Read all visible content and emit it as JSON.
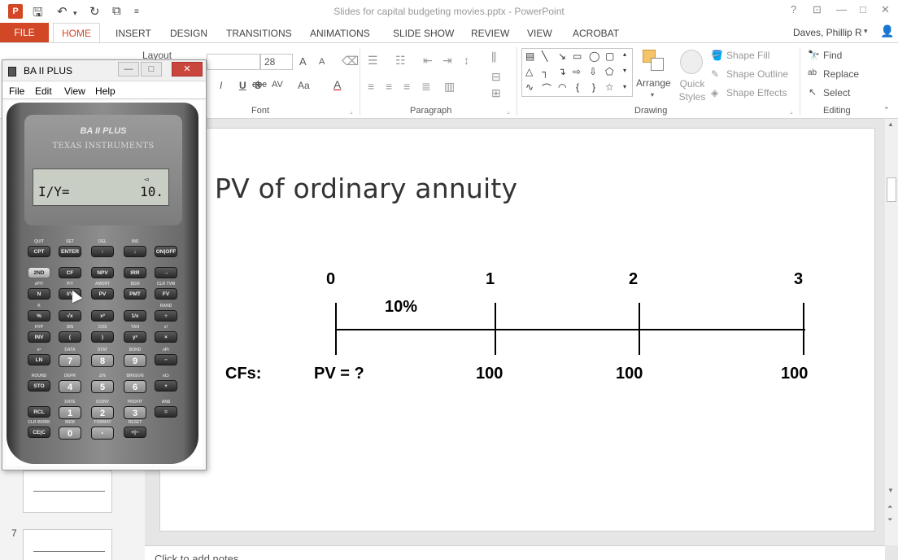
{
  "app": {
    "app_icon_label": "P",
    "title": "Slides for capital budgeting movies.pptx - PowerPoint",
    "window_controls": {
      "help": "?",
      "restore_ribbon": "⊡",
      "minimize": "—",
      "maximize": "□",
      "close": "✕"
    }
  },
  "quick_access": {
    "save_icon": "floppy-icon",
    "undo_icon": "undo-icon",
    "redo_icon": "redo-icon",
    "present_icon": "present-icon",
    "customize_icon": "chevron-down-icon"
  },
  "ribbon": {
    "tabs": [
      "FILE",
      "HOME",
      "INSERT",
      "DESIGN",
      "TRANSITIONS",
      "ANIMATIONS",
      "SLIDE SHOW",
      "REVIEW",
      "VIEW",
      "ACROBAT"
    ],
    "active_tab": "HOME",
    "user": "Daves, Phillip R",
    "groups": {
      "font": {
        "label": "Font",
        "font_size": "28",
        "bold": "B",
        "italic": "I",
        "underline": "U",
        "shadow": "S",
        "strike": "abc",
        "spacing": "AV",
        "case": "Aa",
        "color": "A",
        "grow": "A",
        "shrink": "A"
      },
      "paragraph": {
        "label": "Paragraph"
      },
      "drawing": {
        "label": "Drawing",
        "arrange": "Arrange",
        "quick_styles": "Quick Styles",
        "shape_fill": "Shape Fill",
        "shape_outline": "Shape Outline",
        "shape_effects": "Shape Effects"
      },
      "editing": {
        "label": "Editing",
        "find": "Find",
        "replace": "Replace",
        "select": "Select"
      },
      "slides": {
        "layout": "Layout"
      }
    }
  },
  "calculator_window": {
    "title": "BA II PLUS",
    "menu": [
      "File",
      "Edit",
      "View",
      "Help"
    ],
    "brand": "BA II PLUS",
    "maker": "TEXAS INSTRUMENTS",
    "display": {
      "label": "I/Y=",
      "value": "10.",
      "indicator": "◅"
    },
    "keys": [
      {
        "sec": "QUIT",
        "label": "CPT"
      },
      {
        "sec": "SET",
        "label": "ENTER"
      },
      {
        "sec": "DEL",
        "label": "↑"
      },
      {
        "sec": "INS",
        "label": "↓"
      },
      {
        "sec": "",
        "label": "ON|OFF"
      },
      {
        "sec": "",
        "label": "2ND"
      },
      {
        "sec": "",
        "label": "CF"
      },
      {
        "sec": "",
        "label": "NPV"
      },
      {
        "sec": "",
        "label": "IRR"
      },
      {
        "sec": "",
        "label": "→"
      },
      {
        "sec": "xP/Y",
        "label": "N"
      },
      {
        "sec": "P/Y",
        "label": "I/Y"
      },
      {
        "sec": "AMORT",
        "label": "PV"
      },
      {
        "sec": "BGN",
        "label": "PMT"
      },
      {
        "sec": "CLR TVM",
        "label": "FV"
      },
      {
        "sec": "K",
        "label": "%"
      },
      {
        "sec": "",
        "label": "√x"
      },
      {
        "sec": "",
        "label": "x²"
      },
      {
        "sec": "",
        "label": "1/x"
      },
      {
        "sec": "RAND",
        "label": "÷"
      },
      {
        "sec": "HYP",
        "label": "INV"
      },
      {
        "sec": "SIN",
        "label": "("
      },
      {
        "sec": "COS",
        "label": ")"
      },
      {
        "sec": "TAN",
        "label": "yˣ"
      },
      {
        "sec": "x!",
        "label": "×"
      },
      {
        "sec": "eˣ",
        "label": "LN"
      },
      {
        "sec": "DATA",
        "label": "7"
      },
      {
        "sec": "STAT",
        "label": "8"
      },
      {
        "sec": "BOND",
        "label": "9"
      },
      {
        "sec": "nPr",
        "label": "−"
      },
      {
        "sec": "ROUND",
        "label": "STO"
      },
      {
        "sec": "DEPR",
        "label": "4"
      },
      {
        "sec": "Δ%",
        "label": "5"
      },
      {
        "sec": "BRKEVN",
        "label": "6"
      },
      {
        "sec": "nCr",
        "label": "+"
      },
      {
        "sec": "",
        "label": "RCL"
      },
      {
        "sec": "DATE",
        "label": "1"
      },
      {
        "sec": "ICONV",
        "label": "2"
      },
      {
        "sec": "PROFIT",
        "label": "3"
      },
      {
        "sec": "ANS",
        "label": "="
      },
      {
        "sec": "CLR WORK",
        "label": "CE|C"
      },
      {
        "sec": "MEM",
        "label": "0"
      },
      {
        "sec": "FORMAT",
        "label": "·"
      },
      {
        "sec": "RESET",
        "label": "+|−"
      },
      {
        "sec": "",
        "label": ""
      }
    ]
  },
  "slide": {
    "title": "PV of ordinary annuity",
    "periods": [
      "0",
      "1",
      "2",
      "3"
    ],
    "rate": "10%",
    "cf_label": "CFs:",
    "cash_flows": [
      "PV = ?",
      "100",
      "100",
      "100"
    ]
  },
  "thumbnails": [
    {
      "number": ""
    },
    {
      "number": "7"
    }
  ],
  "notes": {
    "placeholder": "Click to add notes"
  }
}
